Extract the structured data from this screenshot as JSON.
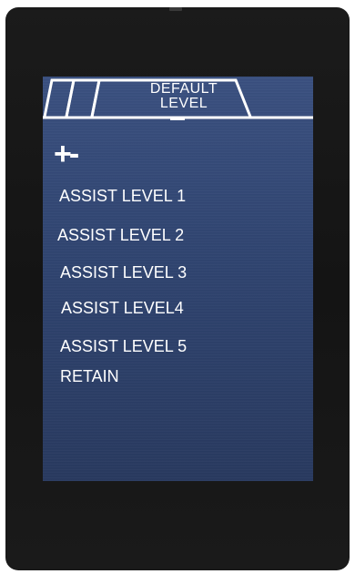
{
  "header": {
    "title_line1": "DEFAULT",
    "title_line2": "LEVEL"
  },
  "adjust_icon_label": "+-",
  "menu": {
    "items": [
      {
        "label": "ASSIST LEVEL 1"
      },
      {
        "label": "ASSIST LEVEL 2"
      },
      {
        "label": "ASSIST LEVEL 3"
      },
      {
        "label": "ASSIST LEVEL4"
      },
      {
        "label": "ASSIST LEVEL 5"
      },
      {
        "label": "RETAIN"
      }
    ]
  },
  "colors": {
    "device_bezel": "#171717",
    "screen_background": "#2f4470",
    "text": "#ffffff"
  }
}
